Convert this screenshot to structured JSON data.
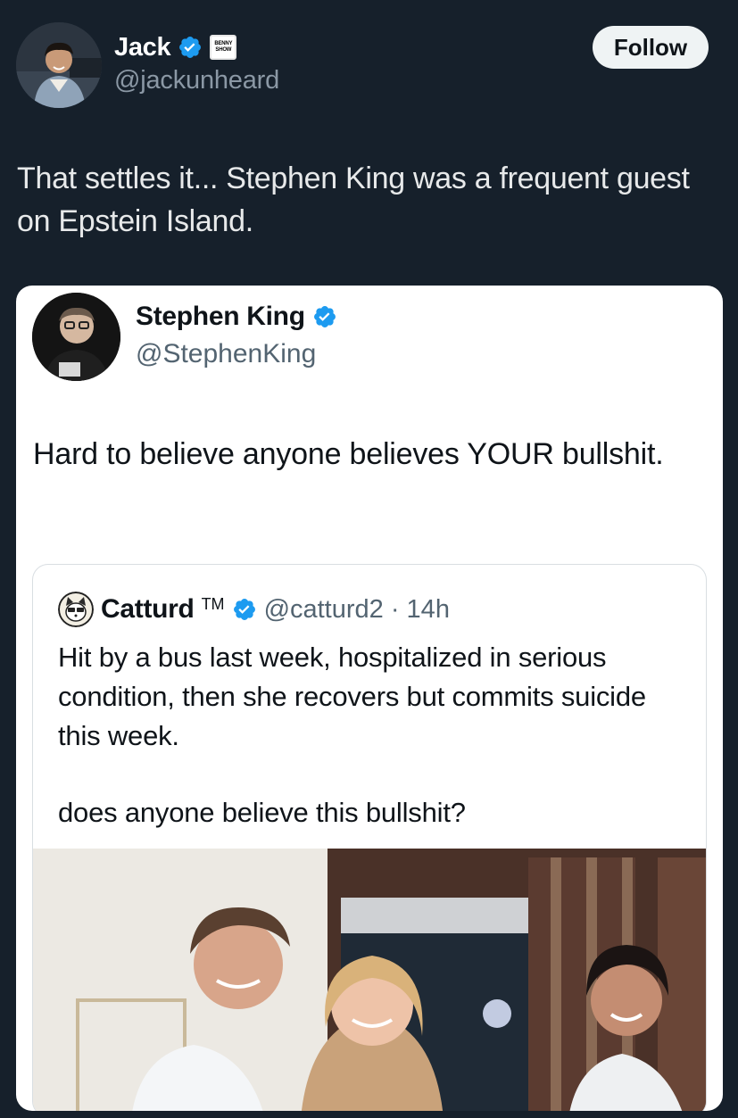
{
  "author": {
    "name": "Jack",
    "handle": "@jackunheard",
    "badge_line1": "BENNY",
    "badge_line2": "SHOW"
  },
  "follow_label": "Follow",
  "tweet": {
    "text": "That settles it... Stephen King was a frequent guest on Epstein Island."
  },
  "quoted": {
    "name": "Stephen King",
    "handle": "@StephenKing",
    "text": "Hard to believe anyone believes YOUR bullshit."
  },
  "nested_quote": {
    "name": "Catturd",
    "tm": "TM",
    "handle_time": "@catturd2 · 14h",
    "text1": "Hit by a bus last week, hospitalized in serious condition, then she recovers but commits suicide this week.",
    "text2": "does anyone believe this bullshit?"
  },
  "colors": {
    "background": "#15202b",
    "verified_blue": "#1d9bf0",
    "card": "#ffffff"
  },
  "icons": {
    "verified": "verified-badge-icon",
    "cat": "cat-avatar-icon"
  }
}
